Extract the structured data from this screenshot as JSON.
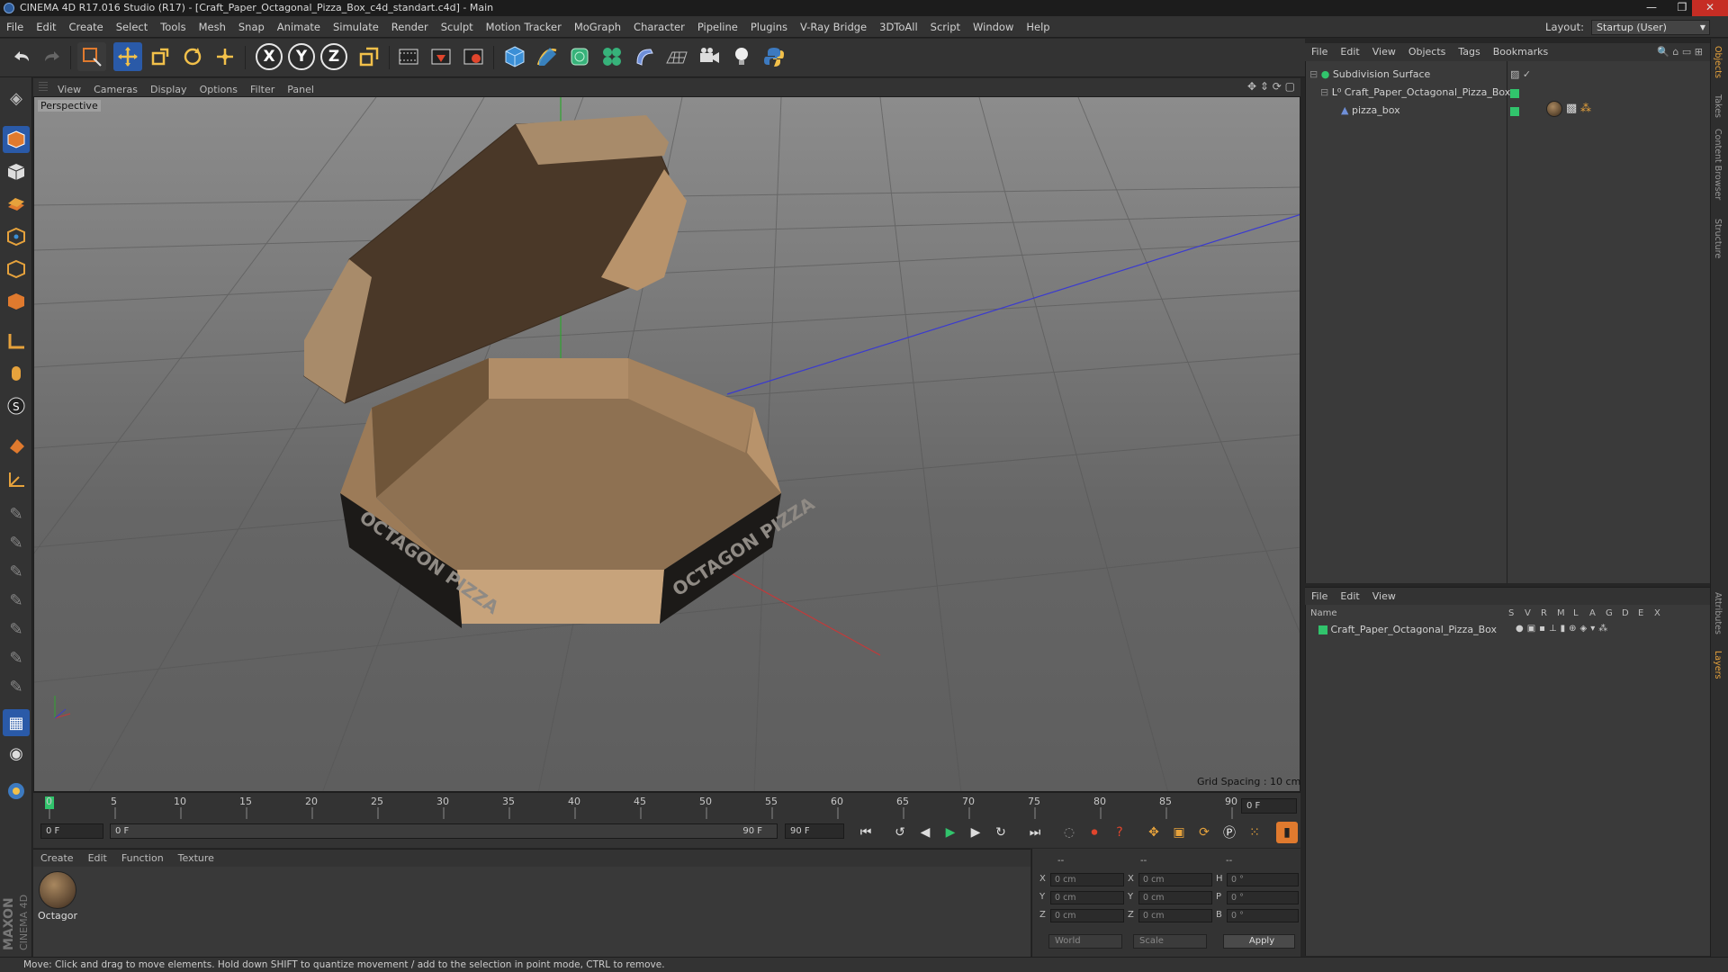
{
  "titlebar": {
    "title": "CINEMA 4D R17.016 Studio (R17) - [Craft_Paper_Octagonal_Pizza_Box_c4d_standart.c4d] - Main",
    "min": "—",
    "max": "❐",
    "close": "✕"
  },
  "menu": [
    "File",
    "Edit",
    "Create",
    "Select",
    "Tools",
    "Mesh",
    "Snap",
    "Animate",
    "Simulate",
    "Render",
    "Sculpt",
    "Motion Tracker",
    "MoGraph",
    "Character",
    "Pipeline",
    "Plugins",
    "V-Ray Bridge",
    "3DToAll",
    "Script",
    "Window",
    "Help"
  ],
  "layout": {
    "label": "Layout:",
    "value": "Startup (User)"
  },
  "toolbar": {
    "axis_x": "X",
    "axis_y": "Y",
    "axis_z": "Z"
  },
  "viewport": {
    "menu": [
      "View",
      "Cameras",
      "Display",
      "Options",
      "Filter",
      "Panel"
    ],
    "label": "Perspective",
    "grid_spacing": "Grid Spacing : 10 cm",
    "box_text": "OCTAGON PIZZA"
  },
  "timeline": {
    "ticks": [
      "0",
      "5",
      "10",
      "15",
      "20",
      "25",
      "30",
      "35",
      "40",
      "45",
      "50",
      "55",
      "60",
      "65",
      "70",
      "75",
      "80",
      "85",
      "90"
    ],
    "current_frame": "0 F",
    "start_field": "0 F",
    "range_start": "0 F",
    "range_end": "90 F",
    "end_field": "90 F"
  },
  "material_manager": {
    "menu": [
      "Create",
      "Edit",
      "Function",
      "Texture"
    ],
    "material_name": "Octagor"
  },
  "coordinates": {
    "header": [
      "--",
      "--",
      "--"
    ],
    "rows": [
      {
        "l1": "X",
        "v1": "0 cm",
        "l2": "X",
        "v2": "0 cm",
        "l3": "H",
        "v3": "0 °"
      },
      {
        "l1": "Y",
        "v1": "0 cm",
        "l2": "Y",
        "v2": "0 cm",
        "l3": "P",
        "v3": "0 °"
      },
      {
        "l1": "Z",
        "v1": "0 cm",
        "l2": "Z",
        "v2": "0 cm",
        "l3": "B",
        "v3": "0 °"
      }
    ],
    "space": "World",
    "mode": "Scale",
    "apply": "Apply"
  },
  "object_manager": {
    "menu": [
      "File",
      "Edit",
      "View",
      "Objects",
      "Tags",
      "Bookmarks"
    ],
    "objects": [
      {
        "name": "Subdivision Surface"
      },
      {
        "name": "Craft_Paper_Octagonal_Pizza_Box"
      },
      {
        "name": "pizza_box"
      }
    ]
  },
  "layer_manager": {
    "menu": [
      "File",
      "Edit",
      "View"
    ],
    "columns": [
      "Name",
      "S",
      "V",
      "R",
      "M",
      "L",
      "A",
      "G",
      "D",
      "E",
      "X"
    ],
    "layers": [
      {
        "name": "Craft_Paper_Octagonal_Pizza_Box"
      }
    ]
  },
  "right_tabs": [
    "Objects",
    "Takes",
    "Content Browser",
    "Structure",
    "Attributes",
    "Layers"
  ],
  "status": "Move: Click and drag to move elements. Hold down SHIFT to quantize movement / add to the selection in point mode, CTRL to remove.",
  "colors": {
    "accent_blue": "#2a5aa8",
    "layer_green": "#31c46c",
    "close_red": "#c62d24"
  }
}
